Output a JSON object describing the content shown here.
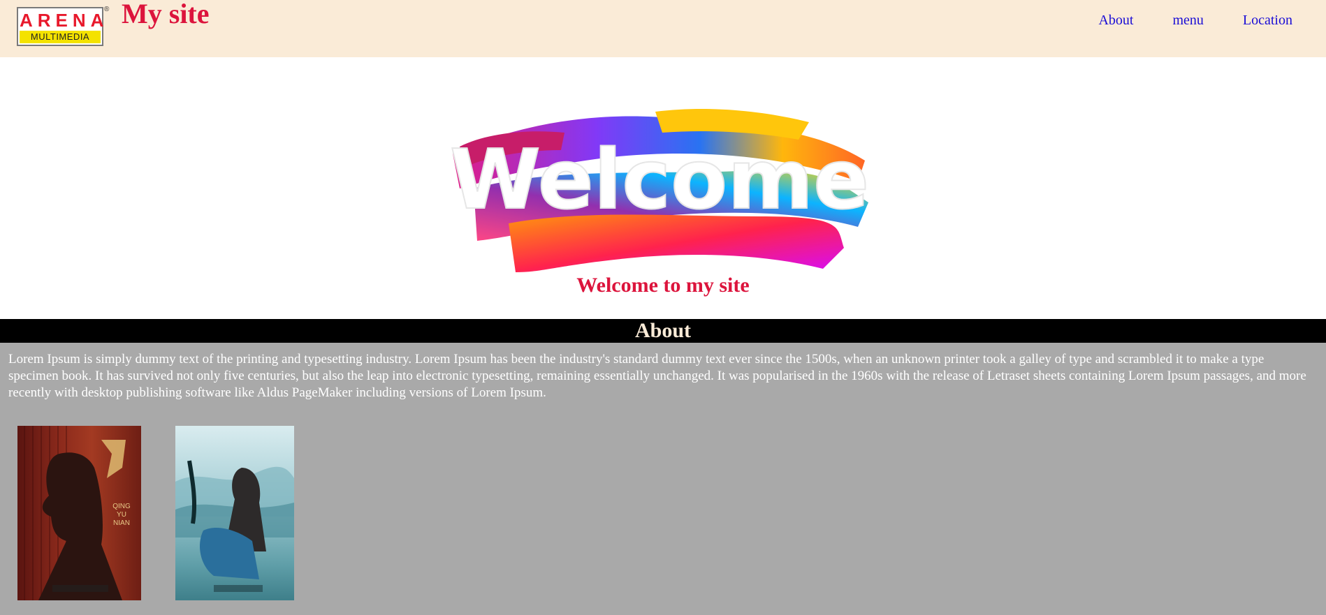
{
  "header": {
    "logo": {
      "top": "ARENA",
      "bottom": "MULTIMEDIA",
      "reg": "®"
    },
    "title": "My site",
    "nav": [
      {
        "label": "About"
      },
      {
        "label": "menu"
      },
      {
        "label": "Location"
      }
    ]
  },
  "hero": {
    "image_text": "Welcome",
    "subtitle": "Welcome to my site"
  },
  "about": {
    "heading": "About",
    "text": "Lorem Ipsum is simply dummy text of the printing and typesetting industry. Lorem Ipsum has been the industry's standard dummy text ever since the 1500s, when an unknown printer took a galley of type and scrambled it to make a type specimen book. It has survived not only five centuries, but also the leap into electronic typesetting, remaining essentially unchanged. It was popularised in the 1960s with the release of Letraset sheets containing Lorem Ipsum passages, and more recently with desktop publishing software like Aldus PageMaker including versions of Lorem Ipsum."
  },
  "posters": [
    {
      "caption": "QING YU NIAN"
    },
    {
      "caption": ""
    }
  ],
  "colors": {
    "header_bg": "#faebd7",
    "title": "#dc143c",
    "nav_link": "#1a0dd6",
    "about_bar": "#000000",
    "content_bg": "#a9a9a9"
  }
}
